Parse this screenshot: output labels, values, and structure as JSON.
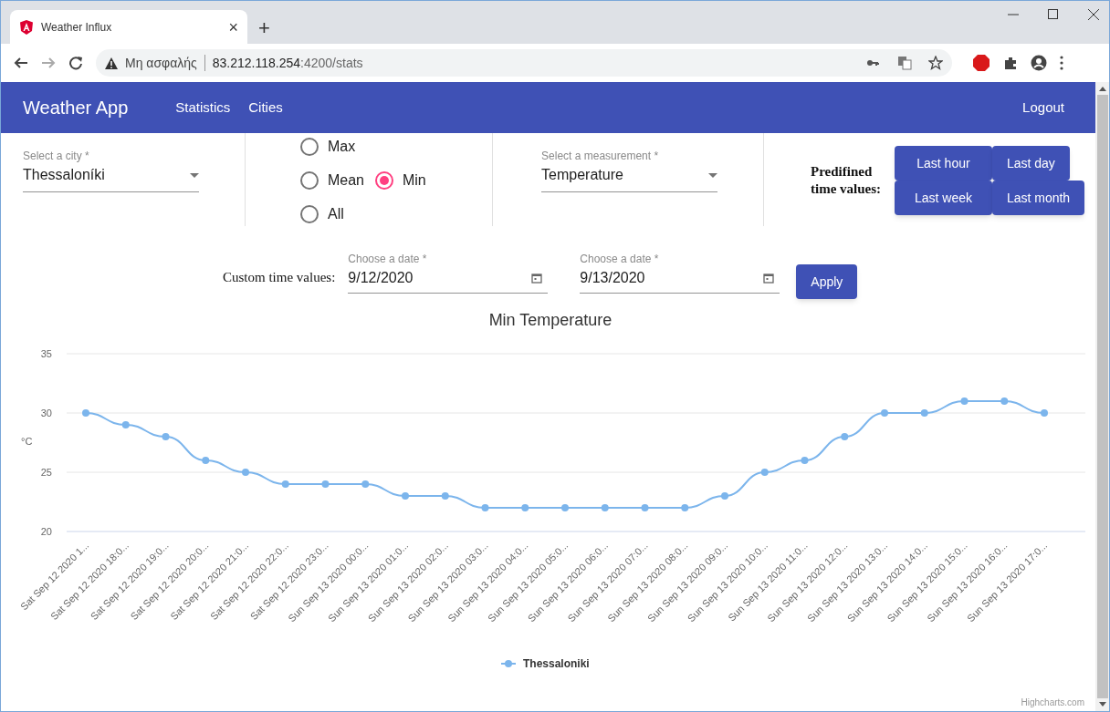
{
  "browser": {
    "tab_title": "Weather Influx",
    "tab_close": "×",
    "new_tab": "+",
    "security": "Μη ασφαλής",
    "url_host": "83.212.118.254",
    "url_rest": ":4200/stats"
  },
  "navbar": {
    "brand": "Weather App",
    "links": [
      "Statistics",
      "Cities"
    ],
    "logout": "Logout"
  },
  "city_select": {
    "label": "Select a city *",
    "value": "Thessaloníki"
  },
  "aggregation": [
    {
      "label": "Max",
      "selected": false
    },
    {
      "label": "Mean",
      "selected": false
    },
    {
      "label": "Min",
      "selected": true
    },
    {
      "label": "All",
      "selected": false
    }
  ],
  "measurement_select": {
    "label": "Select a measurement *",
    "value": "Temperature"
  },
  "predefined": {
    "label": "Predifined time values:",
    "buttons": [
      "Last hour",
      "Last day",
      "Last week",
      "Last month"
    ]
  },
  "custom": {
    "label": "Custom time values:",
    "dates": [
      {
        "label": "Choose a date *",
        "value": "9/12/2020"
      },
      {
        "label": "Choose a date *",
        "value": "9/13/2020"
      }
    ],
    "apply": "Apply"
  },
  "chart": {
    "chart_data": {
      "type": "line",
      "title": "Min Temperature",
      "ylabel": "°C",
      "ylim": [
        20,
        35
      ],
      "yticks": [
        20,
        25,
        30,
        35
      ],
      "categories": [
        "Sat Sep 12 2020 1...",
        "Sat Sep 12 2020 18:0...",
        "Sat Sep 12 2020 19:0...",
        "Sat Sep 12 2020 20:0...",
        "Sat Sep 12 2020 21:0...",
        "Sat Sep 12 2020 22:0...",
        "Sat Sep 12 2020 23:0...",
        "Sun Sep 13 2020 00:0...",
        "Sun Sep 13 2020 01:0...",
        "Sun Sep 13 2020 02:0...",
        "Sun Sep 13 2020 03:0...",
        "Sun Sep 13 2020 04:0...",
        "Sun Sep 13 2020 05:0...",
        "Sun Sep 13 2020 06:0...",
        "Sun Sep 13 2020 07:0...",
        "Sun Sep 13 2020 08:0...",
        "Sun Sep 13 2020 09:0...",
        "Sun Sep 13 2020 10:0...",
        "Sun Sep 13 2020 11:0...",
        "Sun Sep 13 2020 12:0...",
        "Sun Sep 13 2020 13:0...",
        "Sun Sep 13 2020 14:0...",
        "Sun Sep 13 2020 15:0...",
        "Sun Sep 13 2020 16:0...",
        "Sun Sep 13 2020 17:0..."
      ],
      "series": [
        {
          "name": "Thessaloniki",
          "color": "#7cb5ec",
          "marker": true,
          "values": [
            30,
            29,
            28,
            26,
            25,
            24,
            24,
            24,
            23,
            23,
            22,
            22,
            22,
            22,
            22,
            22,
            23,
            25,
            26,
            28,
            30,
            30,
            31,
            31,
            30
          ]
        }
      ]
    },
    "credits": "Highcharts.com"
  }
}
